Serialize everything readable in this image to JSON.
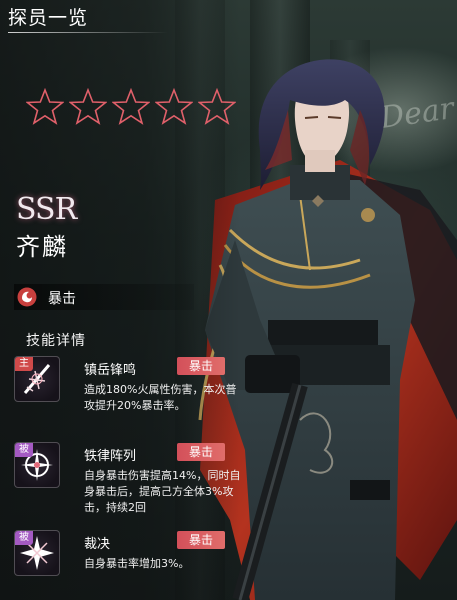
{
  "header": {
    "title": "探员一览"
  },
  "background": {
    "script_text": "Dear"
  },
  "agent": {
    "stars": 5,
    "rarity": "SSR",
    "name": "齐麟",
    "tag": {
      "icon": "crit-type-icon",
      "label": "暴击"
    }
  },
  "skills": {
    "title": "技能详情",
    "items": [
      {
        "kind": "主",
        "icon": "slash-burst-icon",
        "name": "镇岳锋鸣",
        "badge": "暴击",
        "desc": "造成180%火属性伤害，本次普攻提升20%暴击率。"
      },
      {
        "kind": "被",
        "icon": "radiant-star-icon",
        "name": "铁律阵列",
        "badge": "暴击",
        "desc": "自身暴击伤害提高14%，同时自身暴击后，提高己方全体3%攻击，持续2回"
      },
      {
        "kind": "被",
        "icon": "spark-star-icon",
        "name": "裁决",
        "badge": "暴击",
        "desc": "自身暴击率增加3%。"
      }
    ]
  },
  "colors": {
    "star_outline": "#e0606a",
    "badge": "#d3505a",
    "active_tag": "#d04a4a",
    "passive_tag": "#a45ac2"
  }
}
